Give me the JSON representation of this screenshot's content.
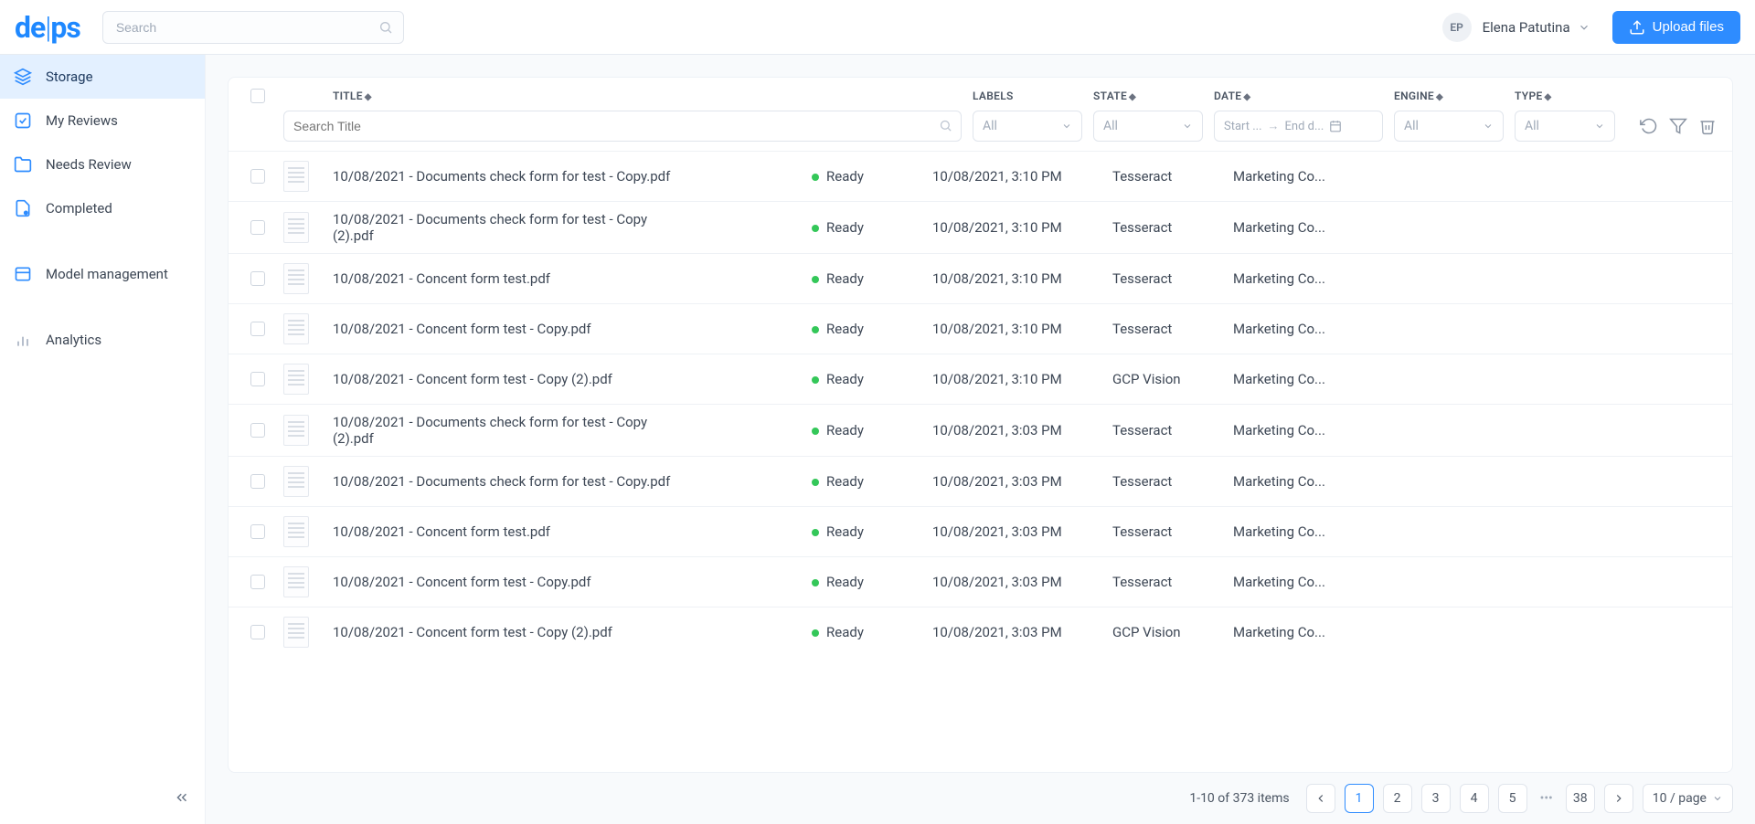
{
  "header": {
    "logo_left": "de",
    "logo_right": "ps",
    "search_placeholder": "Search",
    "user_initials": "EP",
    "user_name": "Elena Patutina",
    "upload_label": "Upload files"
  },
  "sidebar": {
    "items": [
      {
        "label": "Storage",
        "active": true
      },
      {
        "label": "My Reviews",
        "active": false
      },
      {
        "label": "Needs Review",
        "active": false
      },
      {
        "label": "Completed",
        "active": false
      },
      {
        "label": "Model management",
        "active": false
      },
      {
        "label": "Analytics",
        "active": false
      }
    ]
  },
  "table": {
    "columns": {
      "title": "TITLE",
      "labels": "LABELS",
      "state": "STATE",
      "date": "DATE",
      "engine": "ENGINE",
      "type": "TYPE"
    },
    "filters": {
      "title_placeholder": "Search Title",
      "labels_placeholder": "All",
      "state_placeholder": "All",
      "date_start_placeholder": "Start ...",
      "date_end_placeholder": "End d...",
      "engine_placeholder": "All",
      "type_placeholder": "All"
    },
    "rows": [
      {
        "title": "10/08/2021 - Documents check form for test - Copy.pdf",
        "state": "Ready",
        "date": "10/08/2021, 3:10 PM",
        "engine": "Tesseract",
        "type": "Marketing Co..."
      },
      {
        "title": "10/08/2021 - Documents check form for test - Copy (2).pdf",
        "state": "Ready",
        "date": "10/08/2021, 3:10 PM",
        "engine": "Tesseract",
        "type": "Marketing Co..."
      },
      {
        "title": "10/08/2021 - Concent form test.pdf",
        "state": "Ready",
        "date": "10/08/2021, 3:10 PM",
        "engine": "Tesseract",
        "type": "Marketing Co..."
      },
      {
        "title": "10/08/2021 - Concent form test - Copy.pdf",
        "state": "Ready",
        "date": "10/08/2021, 3:10 PM",
        "engine": "Tesseract",
        "type": "Marketing Co..."
      },
      {
        "title": "10/08/2021 - Concent form test - Copy (2).pdf",
        "state": "Ready",
        "date": "10/08/2021, 3:10 PM",
        "engine": "GCP Vision",
        "type": "Marketing Co..."
      },
      {
        "title": "10/08/2021 - Documents check form for test - Copy (2).pdf",
        "state": "Ready",
        "date": "10/08/2021, 3:03 PM",
        "engine": "Tesseract",
        "type": "Marketing Co..."
      },
      {
        "title": "10/08/2021 - Documents check form for test - Copy.pdf",
        "state": "Ready",
        "date": "10/08/2021, 3:03 PM",
        "engine": "Tesseract",
        "type": "Marketing Co..."
      },
      {
        "title": "10/08/2021 - Concent form test.pdf",
        "state": "Ready",
        "date": "10/08/2021, 3:03 PM",
        "engine": "Tesseract",
        "type": "Marketing Co..."
      },
      {
        "title": "10/08/2021 - Concent form test - Copy.pdf",
        "state": "Ready",
        "date": "10/08/2021, 3:03 PM",
        "engine": "Tesseract",
        "type": "Marketing Co..."
      },
      {
        "title": "10/08/2021 - Concent form test - Copy (2).pdf",
        "state": "Ready",
        "date": "10/08/2021, 3:03 PM",
        "engine": "GCP Vision",
        "type": "Marketing Co..."
      }
    ]
  },
  "pagination": {
    "summary": "1-10 of 373 items",
    "pages": [
      "1",
      "2",
      "3",
      "4",
      "5"
    ],
    "last_page": "38",
    "page_size": "10 / page"
  }
}
